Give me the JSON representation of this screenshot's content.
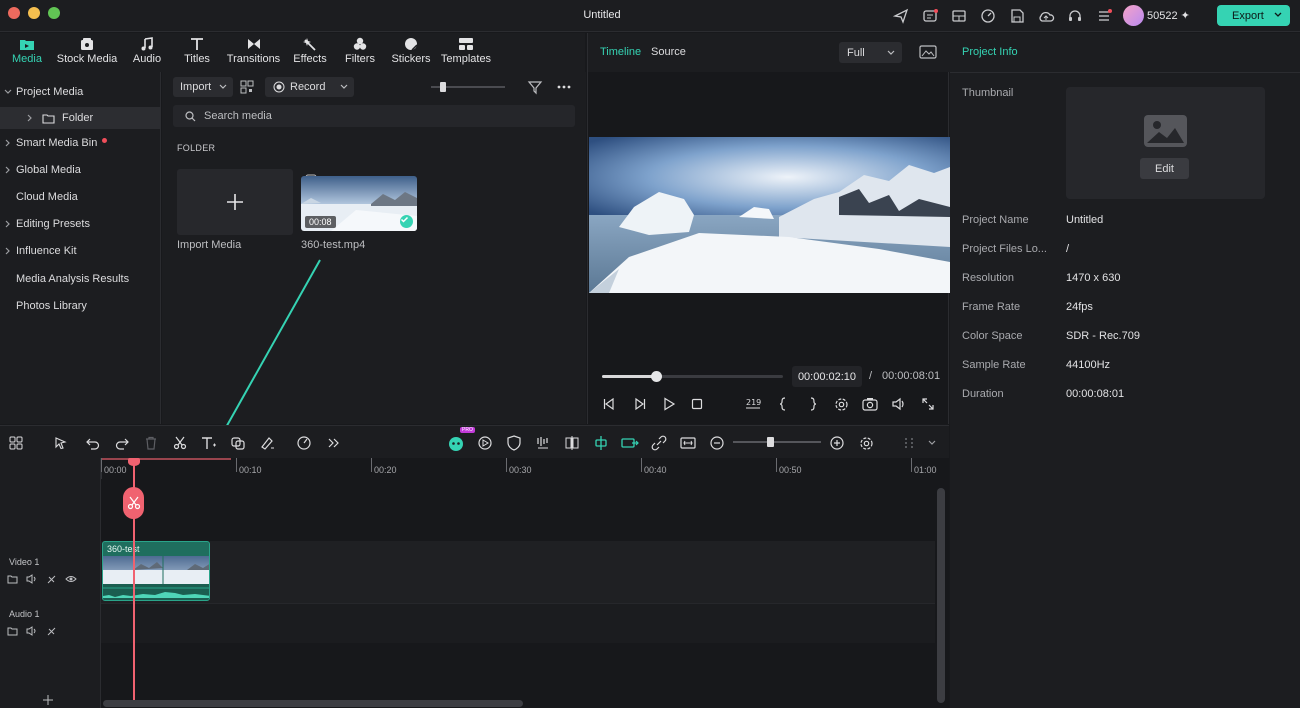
{
  "app": {
    "title": "Untitled",
    "credits": "50522",
    "export_label": "Export",
    "accent": "#35d3b3"
  },
  "top_tabs": [
    {
      "label": "Media",
      "icon": "media-folder-icon",
      "active": true
    },
    {
      "label": "Stock Media",
      "icon": "stock-media-icon"
    },
    {
      "label": "Audio",
      "icon": "music-note-icon"
    },
    {
      "label": "Titles",
      "icon": "text-t-icon"
    },
    {
      "label": "Transitions",
      "icon": "transition-bowtie-icon"
    },
    {
      "label": "Effects",
      "icon": "effects-sparkle-icon"
    },
    {
      "label": "Filters",
      "icon": "filters-circles-icon"
    },
    {
      "label": "Stickers",
      "icon": "sticker-icon"
    },
    {
      "label": "Templates",
      "icon": "templates-grid-icon"
    }
  ],
  "sidebar": {
    "items": [
      {
        "label": "Project Media",
        "expanded": true
      },
      {
        "label": "Folder",
        "sub": true
      },
      {
        "label": "Smart Media Bin"
      },
      {
        "label": "Global Media"
      },
      {
        "label": "Cloud Media"
      },
      {
        "label": "Editing Presets"
      },
      {
        "label": "Influence Kit"
      },
      {
        "label": "Media Analysis Results"
      },
      {
        "label": "Photos Library"
      }
    ]
  },
  "media": {
    "import_label": "Import",
    "record_label": "Record",
    "search_placeholder": "Search media",
    "folder_heading": "FOLDER",
    "import_tile_label": "Import Media",
    "clip": {
      "name": "360-test.mp4",
      "duration": "00:08"
    }
  },
  "player": {
    "tab_timeline": "Timeline",
    "tab_source": "Source",
    "zoom": "Full",
    "current_time": "00:00:02:10",
    "separator": "/",
    "total_time": "00:00:08:01",
    "progress": 0.3
  },
  "info": {
    "title": "Project Info",
    "thumbnail_label": "Thumbnail",
    "edit_label": "Edit",
    "rows": [
      {
        "k": "Project Name",
        "v": "Untitled"
      },
      {
        "k": "Project Files Lo...",
        "v": "/"
      },
      {
        "k": "Resolution",
        "v": "1470 x 630"
      },
      {
        "k": "Frame Rate",
        "v": "24fps"
      },
      {
        "k": "Color Space",
        "v": "SDR - Rec.709"
      },
      {
        "k": "Sample Rate",
        "v": "44100Hz"
      },
      {
        "k": "Duration",
        "v": "00:00:08:01"
      }
    ]
  },
  "timeline": {
    "ruler": [
      "00:00",
      "00:10",
      "00:20",
      "00:30",
      "00:40",
      "00:50",
      "01:00"
    ],
    "tracks": [
      {
        "label": "Video 1"
      },
      {
        "label": "Audio 1"
      }
    ],
    "clip_name": "360-test",
    "pro_badge": "PRO"
  }
}
